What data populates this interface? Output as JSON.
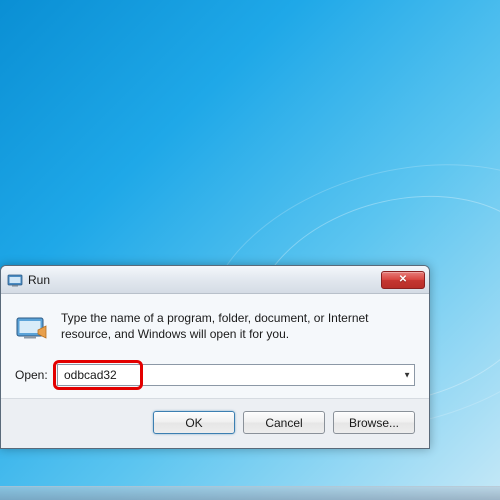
{
  "dialog": {
    "title": "Run",
    "instruction": "Type the name of a program, folder, document, or Internet resource, and Windows will open it for you.",
    "open_label": "Open:",
    "input_value": "odbcad32",
    "buttons": {
      "ok": "OK",
      "cancel": "Cancel",
      "browse": "Browse..."
    }
  }
}
